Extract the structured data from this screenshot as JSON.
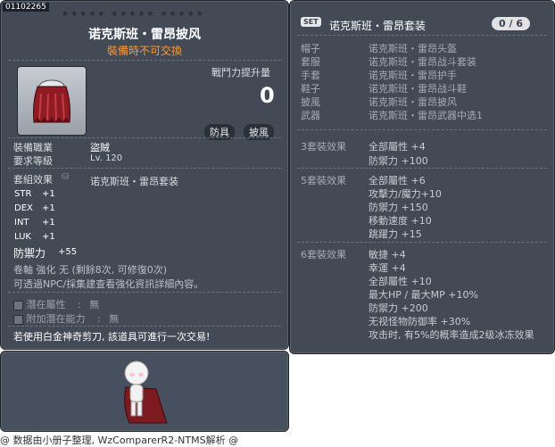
{
  "item": {
    "id": "01102265",
    "stars": "★★★★★  ★★★★★  ★★★★★",
    "name": "诺克斯班・雷昂披风",
    "trade_note": "裝備時不可交換",
    "power_label": "戰鬥力提升量",
    "power_value": "0",
    "tags": [
      "防具",
      "披風"
    ],
    "job_label": "裝備職業",
    "job_value": "盜賊",
    "level_label": "要求等級",
    "level_value": "Lv. 120",
    "set_label": "套組效果",
    "set_name": "诺克斯班・雷昂套装",
    "stats": [
      {
        "name": "STR",
        "value": "+1"
      },
      {
        "name": "DEX",
        "value": "+1"
      },
      {
        "name": "INT",
        "value": "+1"
      },
      {
        "name": "LUK",
        "value": "+1"
      }
    ],
    "defense_label": "防禦力",
    "defense_value": "+55",
    "scroll_line": "卷軸 強化 无 (剩餘8次, 可修復0次)",
    "npc_line": "可透過NPC/採集建查看強化資訊詳細內容。",
    "potential_label": "潛在屬性",
    "potential_value": "無",
    "bonus_potential_label": "附加潛在能力",
    "bonus_potential_value": "無",
    "scissors_note": "若使用白金神奇剪刀, 該道具可進行一次交易!"
  },
  "set": {
    "badge": "SET",
    "name": "诺克斯班・雷昂套装",
    "count": "0 / 6",
    "pieces": [
      {
        "slot": "帽子",
        "item": "诺克斯班・雷昂头盔"
      },
      {
        "slot": "套服",
        "item": "诺克斯班・雷昂战斗套装"
      },
      {
        "slot": "手套",
        "item": "诺克斯班・雷昂护手"
      },
      {
        "slot": "鞋子",
        "item": "诺克斯班・雷昂战斗鞋"
      },
      {
        "slot": "披風",
        "item": "诺克斯班・雷昂披风"
      },
      {
        "slot": "武器",
        "item": "诺克斯班・雷昂武器中选1"
      }
    ],
    "effects": [
      {
        "label": "3套裝效果",
        "lines": [
          "全部屬性 +4",
          "防禦力 +100"
        ]
      },
      {
        "label": "5套裝效果",
        "lines": [
          "全部屬性 +6",
          "攻擊力/魔力+10",
          "防禦力 +150",
          "移動速度 +10",
          "跳躍力 +15"
        ]
      },
      {
        "label": "6套裝效果",
        "lines": [
          "敏捷 +4",
          "幸運 +4",
          "全部屬性 +10",
          "最大HP / 最大MP +10%",
          "防禦力 +200",
          "无视怪物防御率 +30%",
          "攻击时, 有5%的概率造成2级冰冻效果"
        ]
      }
    ]
  },
  "footer": "@ 数据由小册子整理, WzComparerR2-NTMS解析 @",
  "colors": {
    "panel": "#424a56",
    "subtitle": "#ff9a2f",
    "title": "#ffffff"
  }
}
